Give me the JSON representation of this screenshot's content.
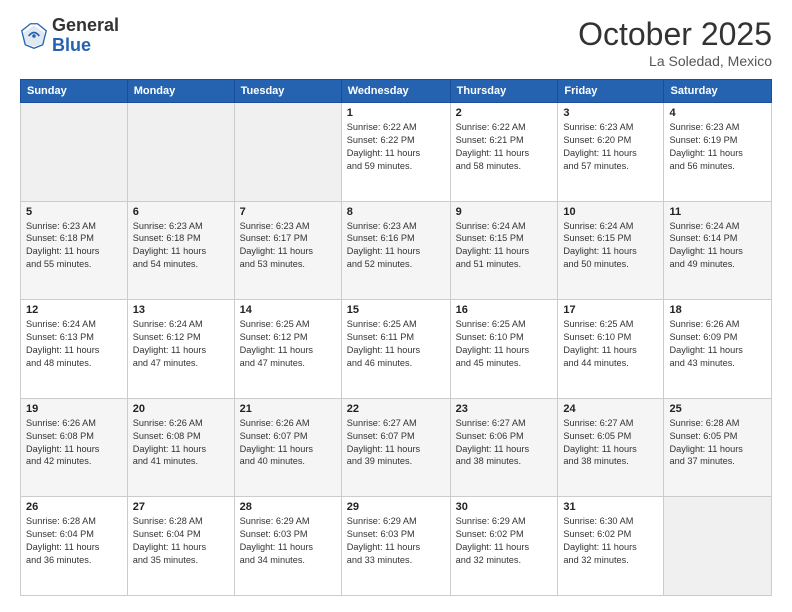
{
  "logo": {
    "line1": "General",
    "line2": "Blue"
  },
  "header": {
    "month": "October 2025",
    "location": "La Soledad, Mexico"
  },
  "weekdays": [
    "Sunday",
    "Monday",
    "Tuesday",
    "Wednesday",
    "Thursday",
    "Friday",
    "Saturday"
  ],
  "weeks": [
    [
      {
        "day": "",
        "info": ""
      },
      {
        "day": "",
        "info": ""
      },
      {
        "day": "",
        "info": ""
      },
      {
        "day": "1",
        "info": "Sunrise: 6:22 AM\nSunset: 6:22 PM\nDaylight: 11 hours\nand 59 minutes."
      },
      {
        "day": "2",
        "info": "Sunrise: 6:22 AM\nSunset: 6:21 PM\nDaylight: 11 hours\nand 58 minutes."
      },
      {
        "day": "3",
        "info": "Sunrise: 6:23 AM\nSunset: 6:20 PM\nDaylight: 11 hours\nand 57 minutes."
      },
      {
        "day": "4",
        "info": "Sunrise: 6:23 AM\nSunset: 6:19 PM\nDaylight: 11 hours\nand 56 minutes."
      }
    ],
    [
      {
        "day": "5",
        "info": "Sunrise: 6:23 AM\nSunset: 6:18 PM\nDaylight: 11 hours\nand 55 minutes."
      },
      {
        "day": "6",
        "info": "Sunrise: 6:23 AM\nSunset: 6:18 PM\nDaylight: 11 hours\nand 54 minutes."
      },
      {
        "day": "7",
        "info": "Sunrise: 6:23 AM\nSunset: 6:17 PM\nDaylight: 11 hours\nand 53 minutes."
      },
      {
        "day": "8",
        "info": "Sunrise: 6:23 AM\nSunset: 6:16 PM\nDaylight: 11 hours\nand 52 minutes."
      },
      {
        "day": "9",
        "info": "Sunrise: 6:24 AM\nSunset: 6:15 PM\nDaylight: 11 hours\nand 51 minutes."
      },
      {
        "day": "10",
        "info": "Sunrise: 6:24 AM\nSunset: 6:15 PM\nDaylight: 11 hours\nand 50 minutes."
      },
      {
        "day": "11",
        "info": "Sunrise: 6:24 AM\nSunset: 6:14 PM\nDaylight: 11 hours\nand 49 minutes."
      }
    ],
    [
      {
        "day": "12",
        "info": "Sunrise: 6:24 AM\nSunset: 6:13 PM\nDaylight: 11 hours\nand 48 minutes."
      },
      {
        "day": "13",
        "info": "Sunrise: 6:24 AM\nSunset: 6:12 PM\nDaylight: 11 hours\nand 47 minutes."
      },
      {
        "day": "14",
        "info": "Sunrise: 6:25 AM\nSunset: 6:12 PM\nDaylight: 11 hours\nand 47 minutes."
      },
      {
        "day": "15",
        "info": "Sunrise: 6:25 AM\nSunset: 6:11 PM\nDaylight: 11 hours\nand 46 minutes."
      },
      {
        "day": "16",
        "info": "Sunrise: 6:25 AM\nSunset: 6:10 PM\nDaylight: 11 hours\nand 45 minutes."
      },
      {
        "day": "17",
        "info": "Sunrise: 6:25 AM\nSunset: 6:10 PM\nDaylight: 11 hours\nand 44 minutes."
      },
      {
        "day": "18",
        "info": "Sunrise: 6:26 AM\nSunset: 6:09 PM\nDaylight: 11 hours\nand 43 minutes."
      }
    ],
    [
      {
        "day": "19",
        "info": "Sunrise: 6:26 AM\nSunset: 6:08 PM\nDaylight: 11 hours\nand 42 minutes."
      },
      {
        "day": "20",
        "info": "Sunrise: 6:26 AM\nSunset: 6:08 PM\nDaylight: 11 hours\nand 41 minutes."
      },
      {
        "day": "21",
        "info": "Sunrise: 6:26 AM\nSunset: 6:07 PM\nDaylight: 11 hours\nand 40 minutes."
      },
      {
        "day": "22",
        "info": "Sunrise: 6:27 AM\nSunset: 6:07 PM\nDaylight: 11 hours\nand 39 minutes."
      },
      {
        "day": "23",
        "info": "Sunrise: 6:27 AM\nSunset: 6:06 PM\nDaylight: 11 hours\nand 38 minutes."
      },
      {
        "day": "24",
        "info": "Sunrise: 6:27 AM\nSunset: 6:05 PM\nDaylight: 11 hours\nand 38 minutes."
      },
      {
        "day": "25",
        "info": "Sunrise: 6:28 AM\nSunset: 6:05 PM\nDaylight: 11 hours\nand 37 minutes."
      }
    ],
    [
      {
        "day": "26",
        "info": "Sunrise: 6:28 AM\nSunset: 6:04 PM\nDaylight: 11 hours\nand 36 minutes."
      },
      {
        "day": "27",
        "info": "Sunrise: 6:28 AM\nSunset: 6:04 PM\nDaylight: 11 hours\nand 35 minutes."
      },
      {
        "day": "28",
        "info": "Sunrise: 6:29 AM\nSunset: 6:03 PM\nDaylight: 11 hours\nand 34 minutes."
      },
      {
        "day": "29",
        "info": "Sunrise: 6:29 AM\nSunset: 6:03 PM\nDaylight: 11 hours\nand 33 minutes."
      },
      {
        "day": "30",
        "info": "Sunrise: 6:29 AM\nSunset: 6:02 PM\nDaylight: 11 hours\nand 32 minutes."
      },
      {
        "day": "31",
        "info": "Sunrise: 6:30 AM\nSunset: 6:02 PM\nDaylight: 11 hours\nand 32 minutes."
      },
      {
        "day": "",
        "info": ""
      }
    ]
  ]
}
